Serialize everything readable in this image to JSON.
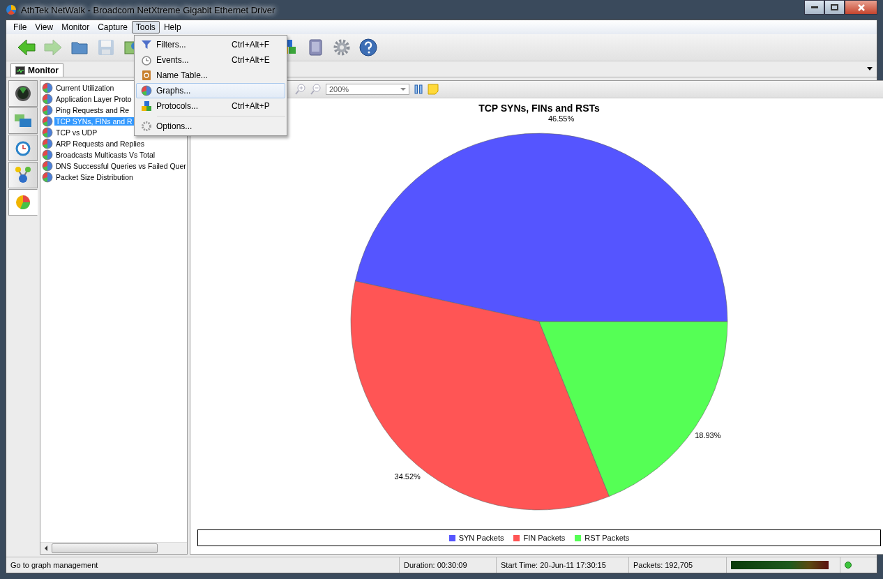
{
  "window": {
    "title": "AthTek NetWalk - Broadcom NetXtreme Gigabit Ethernet Driver"
  },
  "menubar": [
    {
      "label": "File",
      "selected": false
    },
    {
      "label": "View",
      "selected": false
    },
    {
      "label": "Monitor",
      "selected": false
    },
    {
      "label": "Capture",
      "selected": false
    },
    {
      "label": "Tools",
      "selected": true
    },
    {
      "label": "Help",
      "selected": false
    }
  ],
  "toolbar": [
    {
      "kind": "back",
      "disabled": false
    },
    {
      "kind": "forward",
      "disabled": true
    },
    {
      "kind": "folder",
      "disabled": false
    },
    {
      "kind": "save",
      "disabled": true
    },
    {
      "kind": "picture",
      "disabled": false
    },
    {
      "kind": "blocks",
      "disabled": false
    },
    {
      "kind": "book",
      "disabled": false
    },
    {
      "kind": "gear",
      "disabled": false
    },
    {
      "kind": "help",
      "disabled": false
    }
  ],
  "tabs": [
    {
      "label": "Monitor",
      "selected": true
    }
  ],
  "side_tabs": [
    {
      "kind": "radar",
      "selected": false
    },
    {
      "kind": "screens",
      "selected": false
    },
    {
      "kind": "clock",
      "selected": false
    },
    {
      "kind": "network",
      "selected": false
    },
    {
      "kind": "pie",
      "selected": true
    }
  ],
  "tree": {
    "items": [
      {
        "label": "Current Utilization",
        "selected": false
      },
      {
        "label": "Application Layer Proto",
        "selected": false
      },
      {
        "label": "Ping Requests and Re",
        "selected": false
      },
      {
        "label": "TCP SYNs, FINs and R",
        "selected": true
      },
      {
        "label": "TCP vs UDP",
        "selected": false
      },
      {
        "label": "ARP Requests and Replies",
        "selected": false
      },
      {
        "label": "Broadcasts Multicasts Vs Total",
        "selected": false
      },
      {
        "label": "DNS Successful Queries vs Failed Quer",
        "selected": false
      },
      {
        "label": "Packet Size Distribution",
        "selected": false
      }
    ]
  },
  "chart_toolbar": {
    "zoom": "200%"
  },
  "chart": {
    "chart_data": {
      "type": "pie",
      "title": "TCP SYNs, FINs and RSTs",
      "categories": [
        "SYN Packets",
        "FIN Packets",
        "RST Packets"
      ],
      "series": [
        {
          "values": [
            46.55,
            34.52,
            18.93
          ]
        }
      ],
      "colors": [
        "#5555ff",
        "#ff5555",
        "#55ff55"
      ],
      "value_labels": [
        "46.55%",
        "34.52%",
        "18.93%"
      ],
      "legend": "bottom"
    }
  },
  "tools_menu": [
    {
      "kind": "filter",
      "label": "Filters...",
      "shortcut": "Ctrl+Alt+F",
      "selected": false,
      "separator_before": false
    },
    {
      "kind": "clock",
      "label": "Events...",
      "shortcut": "Ctrl+Alt+E",
      "selected": false,
      "separator_before": false
    },
    {
      "kind": "addressbook",
      "label": "Name Table...",
      "selected": false,
      "separator_before": false
    },
    {
      "kind": "pie",
      "label": "Graphs...",
      "selected": true,
      "separator_before": false
    },
    {
      "kind": "blocks",
      "label": "Protocols...",
      "shortcut": "Ctrl+Alt+P",
      "selected": false,
      "separator_before": false
    },
    {
      "kind": "gear",
      "label": "Options...",
      "selected": false,
      "separator_before": true
    }
  ],
  "status_bar": {
    "message": "Go to graph management",
    "duration": "Duration: 00:30:09",
    "start_time": "Start Time: 20-Jun-11 17:30:15",
    "packets": "Packets: 192,705"
  }
}
